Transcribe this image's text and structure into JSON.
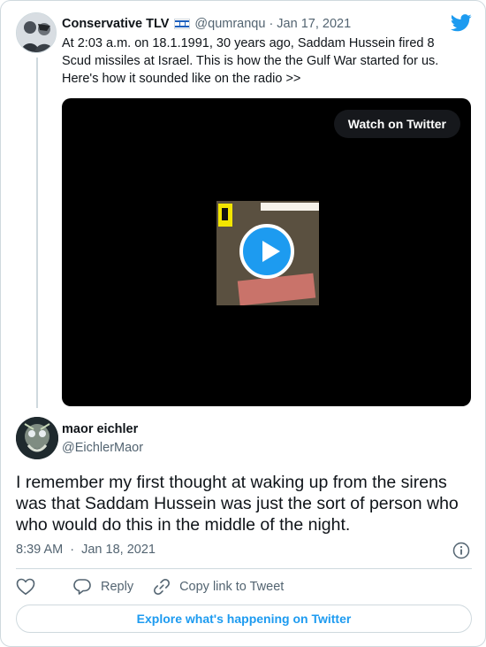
{
  "quoted_tweet": {
    "author_name": "Conservative TLV",
    "author_flag": "🇮🇱",
    "author_handle": "@qumranqu",
    "separator": "·",
    "date": "Jan 17, 2021",
    "text": "At 2:03 a.m. on 18.1.1991, 30 years ago, Saddam Hussein fired 8 Scud missiles at Israel. This is how the the Gulf War started for us. Here's how it sounded like on the radio >>",
    "video": {
      "watch_label": "Watch on Twitter",
      "play_icon": "play-icon"
    }
  },
  "main_tweet": {
    "author_name": "maor eichler",
    "author_handle": "@EichlerMaor",
    "text": "I remember my first thought at waking up from the sirens was that Saddam Hussein was just the sort of person who who would do this in the middle of the night.",
    "time": "8:39 AM",
    "separator": "·",
    "date": "Jan 18, 2021"
  },
  "actions": {
    "like_icon": "heart-icon",
    "reply_label": "Reply",
    "copy_link_label": "Copy link to Tweet"
  },
  "footer": {
    "explore_label": "Explore what's happening on Twitter"
  },
  "colors": {
    "accent": "#1d9bf0",
    "text": "#0f1419",
    "muted": "#536471",
    "border": "#cfd9de"
  }
}
